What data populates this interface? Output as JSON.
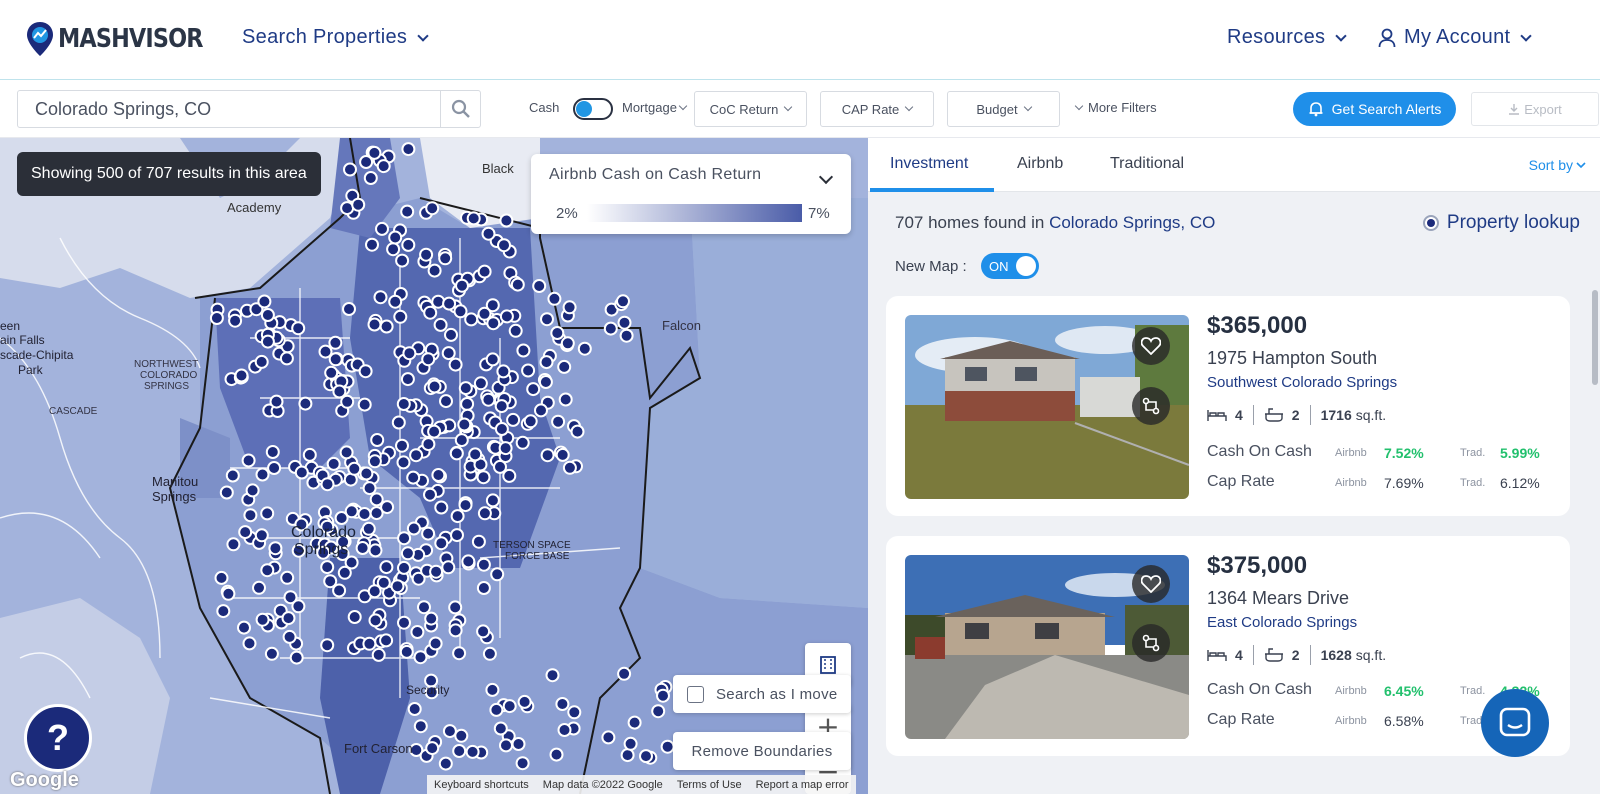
{
  "nav": {
    "brand": "MASHVISOR",
    "search_properties": "Search Properties",
    "resources": "Resources",
    "my_account": "My Account"
  },
  "filters": {
    "location_value": "Colorado Springs, CO",
    "cash_label": "Cash",
    "mortgage_label": "Mortgage",
    "coc_return": "CoC Return",
    "cap_rate": "CAP Rate",
    "budget": "Budget",
    "more_filters": "More Filters",
    "get_alerts": "Get Search Alerts",
    "export": "Export"
  },
  "map": {
    "results_text": "Showing 500 of 707 results in this area",
    "legend_title": "Airbnb Cash on Cash Return",
    "legend_min": "2%",
    "legend_max": "7%",
    "place_labels": [
      "Black",
      "Academy",
      "Falcon",
      "een",
      "ain Falls",
      "scade-Chipita",
      "Park",
      "NORTHWEST",
      "COLORADO",
      "SPRINGS",
      "CASCADE",
      "Manitou",
      "Springs",
      "Colorado",
      "Springs",
      "TERSON SPACE",
      "FORCE BASE",
      "Security",
      "Fort Carson"
    ],
    "search_as_move": "Search as I move",
    "remove_boundaries": "Remove Boundaries",
    "google": "Google",
    "footer": [
      "Keyboard shortcuts",
      "Map data ©2022 Google",
      "Terms of Use",
      "Report a map error"
    ],
    "help": "?",
    "zoom_in": "+",
    "zoom_out": "−"
  },
  "panel": {
    "tabs": [
      "Investment",
      "Airbnb",
      "Traditional"
    ],
    "sort_by": "Sort by",
    "homes_count_text": "707 homes found in",
    "homes_city": "Colorado Springs, CO",
    "property_lookup": "Property lookup",
    "new_map_label": "New Map :",
    "new_map_state": "ON"
  },
  "listings": [
    {
      "price": "$365,000",
      "address": "1975 Hampton South",
      "area": "Southwest Colorado Springs",
      "beds": "4",
      "baths": "2",
      "sqft": "1716",
      "sqft_unit": "sq.ft.",
      "coc_label": "Cash On Cash",
      "cap_label": "Cap Rate",
      "airbnb_tag": "Airbnb",
      "trad_tag": "Trad.",
      "coc_airbnb": "7.52%",
      "coc_trad": "5.99%",
      "cap_airbnb": "7.69%",
      "cap_trad": "6.12%"
    },
    {
      "price": "$375,000",
      "address": "1364 Mears Drive",
      "area": "East Colorado Springs",
      "beds": "4",
      "baths": "2",
      "sqft": "1628",
      "sqft_unit": "sq.ft.",
      "coc_label": "Cash On Cash",
      "cap_label": "Cap Rate",
      "airbnb_tag": "Airbnb",
      "trad_tag": "Trad.",
      "coc_airbnb": "6.45%",
      "coc_trad": "4.32%",
      "cap_airbnb": "6.58%",
      "cap_trad": "4."
    }
  ],
  "colors": {
    "brand_navy": "#1b2a7a",
    "accent_blue": "#1f8fe9",
    "positive_green": "#22c06d",
    "map_fill": "#8fa3d4",
    "marker": "#1b2a7a"
  }
}
